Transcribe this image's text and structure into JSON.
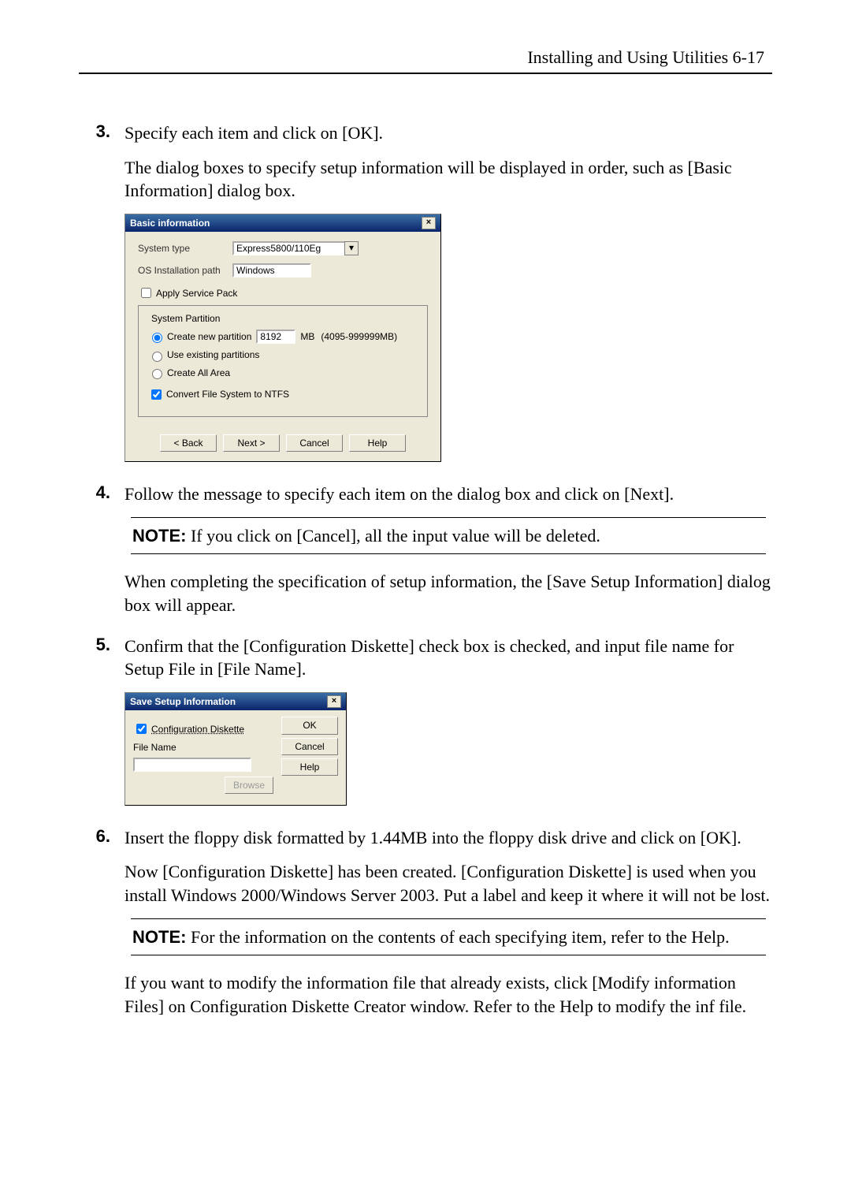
{
  "header": {
    "text": "Installing and Using Utilities    6-17"
  },
  "steps": {
    "s3": {
      "num": "3.",
      "line1": "Specify each item and click on [OK].",
      "line2": "The dialog boxes to specify setup information will be displayed in order, such as [Basic Information] dialog box."
    },
    "s4": {
      "num": "4.",
      "line1": "Follow the message to specify each item on the dialog box and click on [Next].",
      "line2": "When completing the specification of setup information, the [Save Setup Information] dialog box will appear."
    },
    "s5": {
      "num": "5.",
      "line1": "Confirm that the [Configuration Diskette] check box is checked, and input file name for Setup File in [File Name]."
    },
    "s6": {
      "num": "6.",
      "line1": "Insert the floppy disk formatted by 1.44MB into the floppy disk drive and click on [OK].",
      "line2": "Now [Configuration Diskette] has been created.    [Configuration Diskette] is used when you install Windows 2000/Windows Server 2003.    Put a label and keep it where it will not be lost.",
      "line3": "If you want to modify the information file that already exists, click [Modify information Files] on Configuration Diskette Creator window.    Refer to the Help to modify the inf file."
    }
  },
  "notes": {
    "note_label": "NOTE:",
    "cancel_text": "If you click on [Cancel], all the input value will be deleted.",
    "help_text": "For the information on the contents of each specifying item, refer to the Help."
  },
  "dialogs": {
    "common": {
      "close_glyph": "×"
    },
    "basic": {
      "title": "Basic information",
      "system_type_label": "System type",
      "system_type_value": "Express5800/110Eg",
      "os_path_label": "OS Installation path",
      "os_path_value": "Windows",
      "apply_sp_label": "Apply Service Pack",
      "partition_legend": "System Partition",
      "create_new_label": "Create new partition",
      "partition_size": "8192",
      "size_unit": "MB",
      "size_range": "(4095-999999MB)",
      "use_existing_label": "Use existing partitions",
      "create_all_label": "Create All Area",
      "convert_ntfs_label": "Convert File System to NTFS",
      "buttons": {
        "back": "< Back",
        "next": "Next >",
        "cancel": "Cancel",
        "help": "Help"
      }
    },
    "save": {
      "title": "Save Setup Information",
      "config_diskette_label": "Configuration Diskette",
      "file_name_label": "File Name",
      "browse_label": "Browse",
      "buttons": {
        "ok": "OK",
        "cancel": "Cancel",
        "help": "Help"
      }
    }
  }
}
